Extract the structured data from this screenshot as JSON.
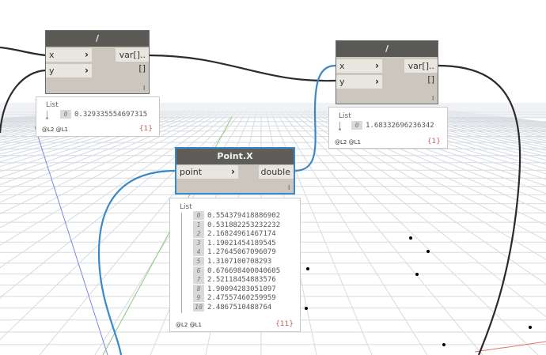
{
  "nodes": {
    "divide_top_left": {
      "title": "/",
      "inputs": [
        "x",
        "y"
      ],
      "output": "var[]..[]",
      "lacing": "l",
      "preview": {
        "header": "List",
        "items": [
          {
            "index": "0",
            "value": "0.329335554697315"
          }
        ],
        "levels": "@L2 @L1",
        "count": "{1}"
      }
    },
    "divide_top_right": {
      "title": "/",
      "inputs": [
        "x",
        "y"
      ],
      "output": "var[]..[]",
      "lacing": "l",
      "preview": {
        "header": "List",
        "items": [
          {
            "index": "0",
            "value": "1.68332696236342"
          }
        ],
        "levels": "@L2 @L1",
        "count": "{1}"
      }
    },
    "point_x": {
      "title": "Point.X",
      "inputs": [
        "point"
      ],
      "output": "double",
      "lacing": "l",
      "preview": {
        "header": "List",
        "items": [
          {
            "index": "0",
            "value": "0.554379418886902"
          },
          {
            "index": "1",
            "value": "0.531882253232232"
          },
          {
            "index": "2",
            "value": "2.16824961467174"
          },
          {
            "index": "3",
            "value": "1.19021454189545"
          },
          {
            "index": "4",
            "value": "1.27645067096079"
          },
          {
            "index": "5",
            "value": "1.3107100708293"
          },
          {
            "index": "6",
            "value": "0.676698400040605"
          },
          {
            "index": "7",
            "value": "2.52118454883576"
          },
          {
            "index": "8",
            "value": "1.90094283051097"
          },
          {
            "index": "9",
            "value": "2.47557460259959"
          },
          {
            "index": "10",
            "value": "2.4867510488764"
          }
        ],
        "levels": "@L2 @L1",
        "count": "{11}"
      }
    }
  },
  "colors": {
    "wire_dark": "#2b2b2b",
    "wire_selected": "#3a88c8",
    "node_header": "#5b5955",
    "node_body": "#cbc6be",
    "grid": "#d8dde2"
  }
}
